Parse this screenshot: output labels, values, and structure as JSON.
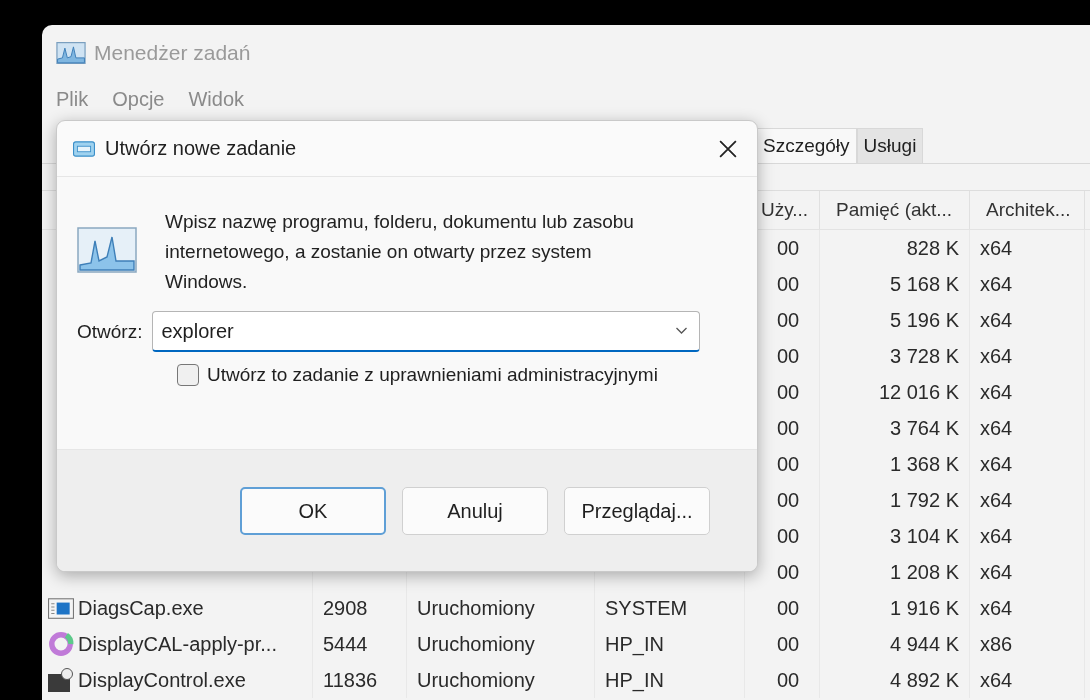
{
  "window": {
    "title": "Menedżer zadań"
  },
  "menu": [
    "Plik",
    "Opcje",
    "Widok"
  ],
  "tabs": [
    {
      "label": "Szczegóły",
      "selected": true
    },
    {
      "label": "Usługi",
      "selected": false
    }
  ],
  "table": {
    "columns": [
      "Uży...",
      "Pamięć (akt...",
      "Architek..."
    ],
    "rows": [
      {
        "cpu": "00",
        "memory": "828 K",
        "arch": "x64"
      },
      {
        "cpu": "00",
        "memory": "5 168 K",
        "arch": "x64"
      },
      {
        "cpu": "00",
        "memory": "5 196 K",
        "arch": "x64"
      },
      {
        "cpu": "00",
        "memory": "3 728 K",
        "arch": "x64"
      },
      {
        "cpu": "00",
        "memory": "12 016 K",
        "arch": "x64"
      },
      {
        "cpu": "00",
        "memory": "3 764 K",
        "arch": "x64"
      },
      {
        "cpu": "00",
        "memory": "1 368 K",
        "arch": "x64"
      },
      {
        "cpu": "00",
        "memory": "1 792 K",
        "arch": "x64"
      },
      {
        "cpu": "00",
        "memory": "3 104 K",
        "arch": "x64"
      },
      {
        "cpu": "00",
        "memory": "1 208 K",
        "arch": "x64"
      },
      {
        "kind": "window",
        "name": "DiagsCap.exe",
        "pid": "2908",
        "status": "Uruchomiony",
        "user": "SYSTEM",
        "cpu": "00",
        "memory": "1 916 K",
        "arch": "x64"
      },
      {
        "kind": "ring",
        "name": "DisplayCAL-apply-pr...",
        "pid": "5444",
        "status": "Uruchomiony",
        "user": "HP_IN",
        "cpu": "00",
        "memory": "4 944 K",
        "arch": "x86"
      },
      {
        "kind": "badge",
        "name": "DisplayControl.exe",
        "pid": "11836",
        "status": "Uruchomiony",
        "user": "HP_IN",
        "cpu": "00",
        "memory": "4 892 K",
        "arch": "x64"
      }
    ]
  },
  "dialog": {
    "title": "Utwórz nowe zadanie",
    "description": "Wpisz nazwę programu, folderu, dokumentu lub zasobu internetowego, a zostanie on otwarty przez system Windows.",
    "open_label": "Otwórz:",
    "open_value": "explorer",
    "admin_checkbox": {
      "label": "Utwórz to zadanie z uprawnieniami administracyjnymi",
      "checked": false
    },
    "buttons": [
      {
        "label": "OK",
        "default": true
      },
      {
        "label": "Anuluj",
        "default": false
      },
      {
        "label": "Przeglądaj...",
        "default": false
      }
    ]
  }
}
